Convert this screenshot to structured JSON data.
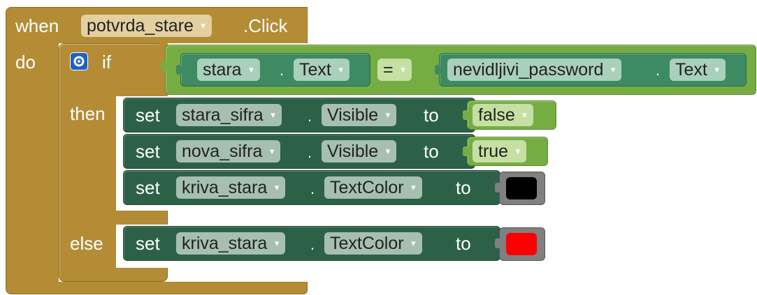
{
  "event": {
    "when_label": "when",
    "component": "potvrda_stare",
    "event_name": ".Click",
    "do_label": "do"
  },
  "if_block": {
    "icon": "gear-icon",
    "if_label": "if",
    "then_label": "then",
    "else_label": "else"
  },
  "condition": {
    "left_component": "stara",
    "left_property": "Text",
    "operator": "=",
    "right_component": "nevidljivi_password",
    "right_property": "Text",
    "dot": "."
  },
  "then_statements": [
    {
      "set_label": "set",
      "component": "stara_sifra",
      "dot": ".",
      "property": "Visible",
      "to_label": "to",
      "value": "false"
    },
    {
      "set_label": "set",
      "component": "nova_sifra",
      "dot": ".",
      "property": "Visible",
      "to_label": "to",
      "value": "true"
    },
    {
      "set_label": "set",
      "component": "kriva_stara",
      "dot": ".",
      "property": "TextColor",
      "to_label": "to",
      "color": "#000000"
    }
  ],
  "else_statements": [
    {
      "set_label": "set",
      "component": "kriva_stara",
      "dot": ".",
      "property": "TextColor",
      "to_label": "to",
      "color": "#ff0000"
    }
  ],
  "colors": {
    "event_block": "#b38c35",
    "setter_block": "#2c6148",
    "logic_block": "#76ad43",
    "getter_block": "#3e8a62",
    "gear": "#1f5fc9"
  },
  "dropdown_arrow": "▾"
}
